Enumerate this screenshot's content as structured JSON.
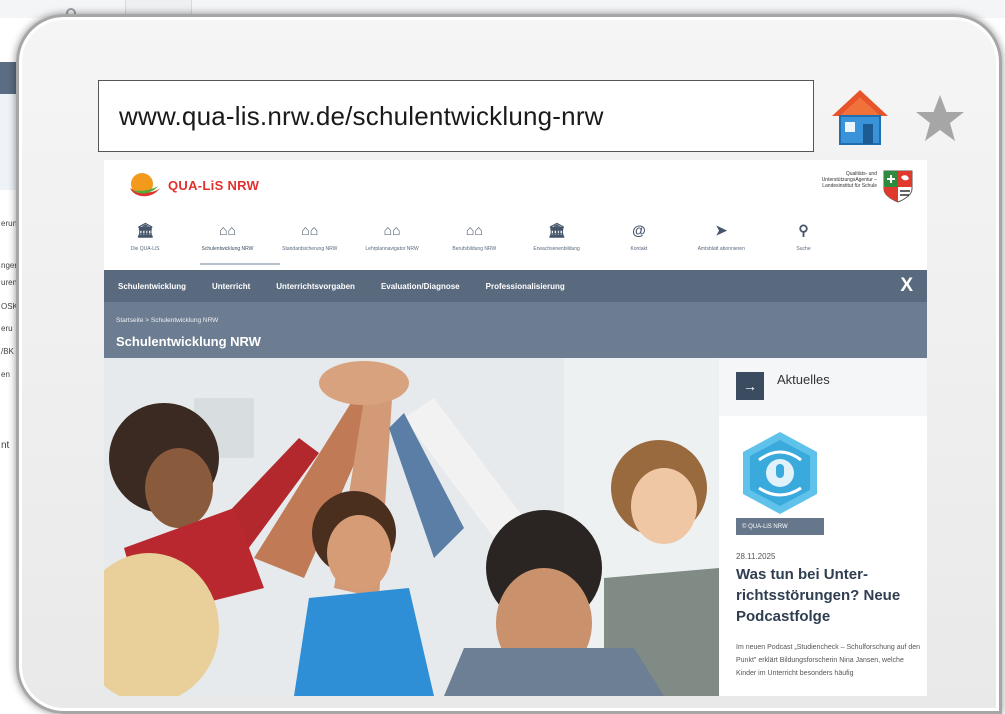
{
  "browser": {
    "url": "www.qua-lis.nrw.de/schulentwicklung-nrw",
    "icons": [
      "home-icon",
      "star-icon"
    ]
  },
  "background_window": {
    "visible_fragments": [
      "erun",
      "nger",
      "uren",
      "OSK",
      "eru",
      "/BK",
      "en",
      "nt"
    ]
  },
  "site": {
    "logo": {
      "part1": "QUA-LiS",
      "part2": "NRW"
    },
    "agency_line1": "Qualitäts- und",
    "agency_line2": "UnterstützungsAgentur –",
    "agency_line3": "Landesinstitut für Schule",
    "main_nav": [
      {
        "label": "Die QUA-LiS",
        "icon": "building-icon"
      },
      {
        "label": "Schulentwicklung NRW",
        "icon": "school-icon"
      },
      {
        "label": "Standardsicherung NRW",
        "icon": "school-icon"
      },
      {
        "label": "Lehrplannavigator NRW",
        "icon": "school-icon"
      },
      {
        "label": "Berufsbildung NRW",
        "icon": "school-icon"
      },
      {
        "label": "Erwachsenenbildung",
        "icon": "building-icon"
      },
      {
        "label": "Kontakt",
        "icon": "at-icon"
      },
      {
        "label": "Amtsblatt abonnieren",
        "icon": "paper-plane-icon"
      },
      {
        "label": "Suche",
        "icon": "search-icon"
      }
    ],
    "sub_nav": [
      "Schulentwicklung",
      "Unterricht",
      "Unterrichtsvorgaben",
      "Evaluation/Diagnose",
      "Professionalisierung"
    ],
    "close_label": "X",
    "breadcrumb": "Startseite  >  Schulentwicklung NRW",
    "page_title": "Schulentwicklung NRW",
    "sidebar": {
      "section_title": "Aktuelles",
      "arrow": "→",
      "image_credit": "© QUA-LiS NRW",
      "date": "28.11.2025",
      "headline": "Was tun bei Unter-richtsstörungen? Neue Podcastfolge",
      "teaser": "Im neuen Podcast „Studiencheck – Schulforschung auf den Punkt\" erklärt Bildungsforscherin Nina Jansen, welche Kinder im Unterricht besonders häufig"
    }
  },
  "colors": {
    "nav_bar": "#596a7e",
    "title_band": "#6c7d92",
    "headline": "#2f3e50",
    "logo_red": "#e2302c"
  }
}
